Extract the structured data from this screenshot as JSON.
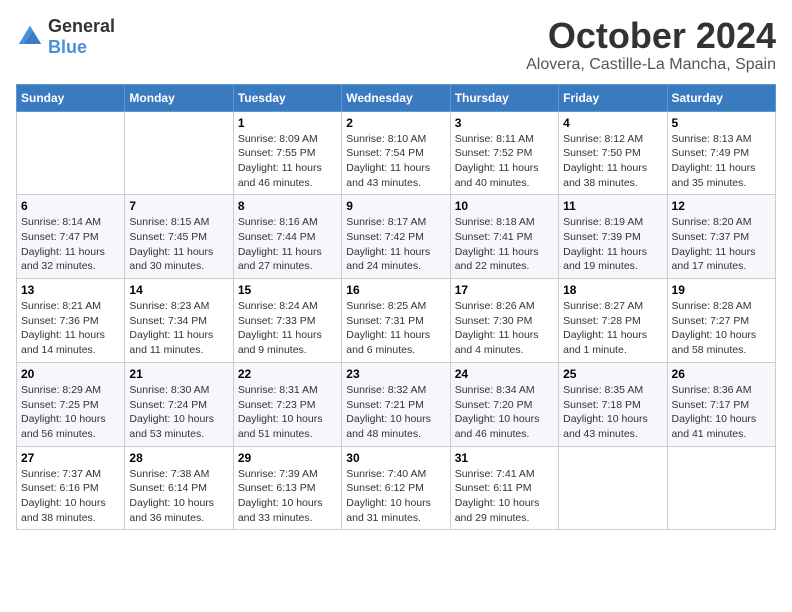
{
  "logo": {
    "text_general": "General",
    "text_blue": "Blue"
  },
  "title": "October 2024",
  "location": "Alovera, Castille-La Mancha, Spain",
  "headers": [
    "Sunday",
    "Monday",
    "Tuesday",
    "Wednesday",
    "Thursday",
    "Friday",
    "Saturday"
  ],
  "weeks": [
    [
      {
        "day": "",
        "info": ""
      },
      {
        "day": "",
        "info": ""
      },
      {
        "day": "1",
        "info": "Sunrise: 8:09 AM\nSunset: 7:55 PM\nDaylight: 11 hours and 46 minutes."
      },
      {
        "day": "2",
        "info": "Sunrise: 8:10 AM\nSunset: 7:54 PM\nDaylight: 11 hours and 43 minutes."
      },
      {
        "day": "3",
        "info": "Sunrise: 8:11 AM\nSunset: 7:52 PM\nDaylight: 11 hours and 40 minutes."
      },
      {
        "day": "4",
        "info": "Sunrise: 8:12 AM\nSunset: 7:50 PM\nDaylight: 11 hours and 38 minutes."
      },
      {
        "day": "5",
        "info": "Sunrise: 8:13 AM\nSunset: 7:49 PM\nDaylight: 11 hours and 35 minutes."
      }
    ],
    [
      {
        "day": "6",
        "info": "Sunrise: 8:14 AM\nSunset: 7:47 PM\nDaylight: 11 hours and 32 minutes."
      },
      {
        "day": "7",
        "info": "Sunrise: 8:15 AM\nSunset: 7:45 PM\nDaylight: 11 hours and 30 minutes."
      },
      {
        "day": "8",
        "info": "Sunrise: 8:16 AM\nSunset: 7:44 PM\nDaylight: 11 hours and 27 minutes."
      },
      {
        "day": "9",
        "info": "Sunrise: 8:17 AM\nSunset: 7:42 PM\nDaylight: 11 hours and 24 minutes."
      },
      {
        "day": "10",
        "info": "Sunrise: 8:18 AM\nSunset: 7:41 PM\nDaylight: 11 hours and 22 minutes."
      },
      {
        "day": "11",
        "info": "Sunrise: 8:19 AM\nSunset: 7:39 PM\nDaylight: 11 hours and 19 minutes."
      },
      {
        "day": "12",
        "info": "Sunrise: 8:20 AM\nSunset: 7:37 PM\nDaylight: 11 hours and 17 minutes."
      }
    ],
    [
      {
        "day": "13",
        "info": "Sunrise: 8:21 AM\nSunset: 7:36 PM\nDaylight: 11 hours and 14 minutes."
      },
      {
        "day": "14",
        "info": "Sunrise: 8:23 AM\nSunset: 7:34 PM\nDaylight: 11 hours and 11 minutes."
      },
      {
        "day": "15",
        "info": "Sunrise: 8:24 AM\nSunset: 7:33 PM\nDaylight: 11 hours and 9 minutes."
      },
      {
        "day": "16",
        "info": "Sunrise: 8:25 AM\nSunset: 7:31 PM\nDaylight: 11 hours and 6 minutes."
      },
      {
        "day": "17",
        "info": "Sunrise: 8:26 AM\nSunset: 7:30 PM\nDaylight: 11 hours and 4 minutes."
      },
      {
        "day": "18",
        "info": "Sunrise: 8:27 AM\nSunset: 7:28 PM\nDaylight: 11 hours and 1 minute."
      },
      {
        "day": "19",
        "info": "Sunrise: 8:28 AM\nSunset: 7:27 PM\nDaylight: 10 hours and 58 minutes."
      }
    ],
    [
      {
        "day": "20",
        "info": "Sunrise: 8:29 AM\nSunset: 7:25 PM\nDaylight: 10 hours and 56 minutes."
      },
      {
        "day": "21",
        "info": "Sunrise: 8:30 AM\nSunset: 7:24 PM\nDaylight: 10 hours and 53 minutes."
      },
      {
        "day": "22",
        "info": "Sunrise: 8:31 AM\nSunset: 7:23 PM\nDaylight: 10 hours and 51 minutes."
      },
      {
        "day": "23",
        "info": "Sunrise: 8:32 AM\nSunset: 7:21 PM\nDaylight: 10 hours and 48 minutes."
      },
      {
        "day": "24",
        "info": "Sunrise: 8:34 AM\nSunset: 7:20 PM\nDaylight: 10 hours and 46 minutes."
      },
      {
        "day": "25",
        "info": "Sunrise: 8:35 AM\nSunset: 7:18 PM\nDaylight: 10 hours and 43 minutes."
      },
      {
        "day": "26",
        "info": "Sunrise: 8:36 AM\nSunset: 7:17 PM\nDaylight: 10 hours and 41 minutes."
      }
    ],
    [
      {
        "day": "27",
        "info": "Sunrise: 7:37 AM\nSunset: 6:16 PM\nDaylight: 10 hours and 38 minutes."
      },
      {
        "day": "28",
        "info": "Sunrise: 7:38 AM\nSunset: 6:14 PM\nDaylight: 10 hours and 36 minutes."
      },
      {
        "day": "29",
        "info": "Sunrise: 7:39 AM\nSunset: 6:13 PM\nDaylight: 10 hours and 33 minutes."
      },
      {
        "day": "30",
        "info": "Sunrise: 7:40 AM\nSunset: 6:12 PM\nDaylight: 10 hours and 31 minutes."
      },
      {
        "day": "31",
        "info": "Sunrise: 7:41 AM\nSunset: 6:11 PM\nDaylight: 10 hours and 29 minutes."
      },
      {
        "day": "",
        "info": ""
      },
      {
        "day": "",
        "info": ""
      }
    ]
  ]
}
